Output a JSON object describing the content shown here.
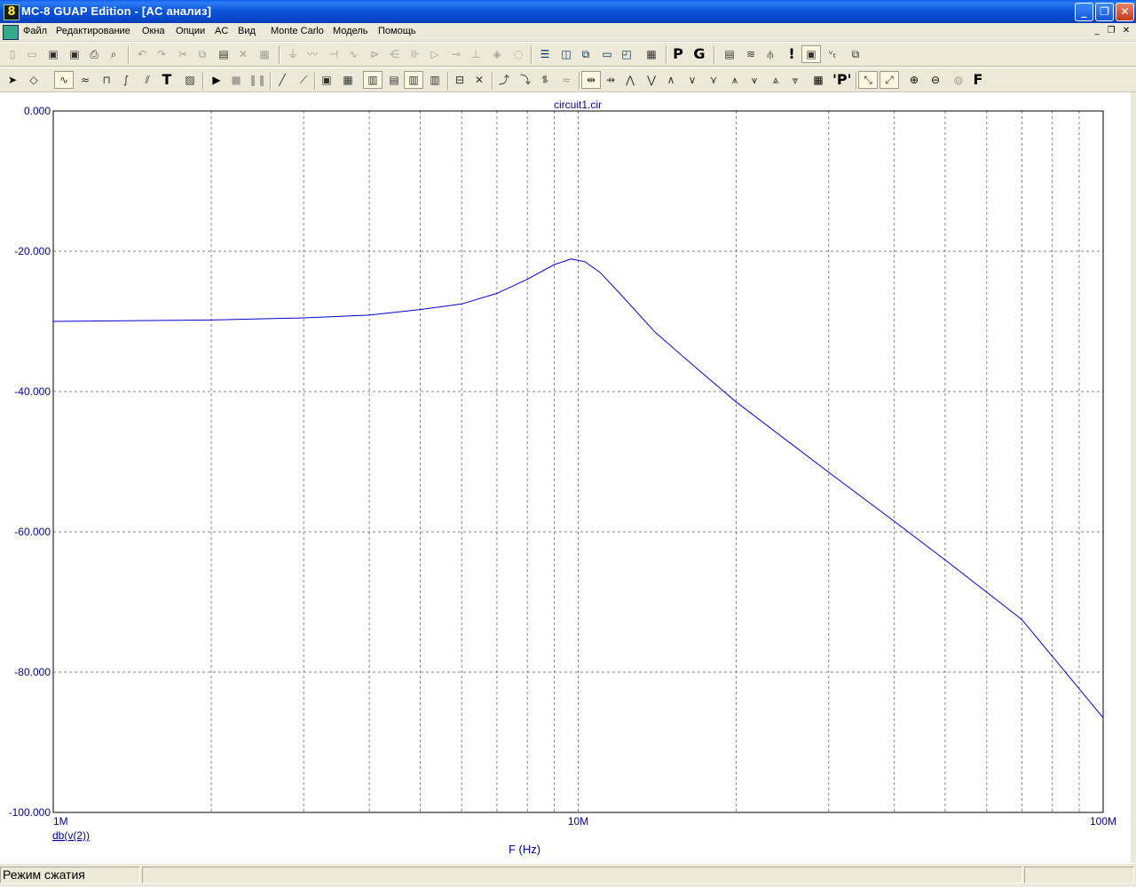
{
  "window": {
    "title": "MC-8 GUAP Edition - [AC анализ]",
    "app_icon_glyph": "8",
    "minimize_glyph": "_",
    "restore_glyph": "❐",
    "close_glyph": "✕"
  },
  "menu": {
    "items": [
      "Файл",
      "Редактирование",
      "Окна",
      "Опции",
      "AC",
      "Вид",
      "Monte Carlo",
      "Модель",
      "Помощь"
    ],
    "mdi_minimize": "_",
    "mdi_restore": "❐",
    "mdi_close": "✕"
  },
  "toolbar1": {
    "p_label": "P",
    "g_label": "G"
  },
  "toolbar2": {
    "text_tool": "T",
    "p_quote_label": "'P'",
    "f_label": "F"
  },
  "plot": {
    "title": "circuit1.cir",
    "xlabel": "F (Hz)",
    "trace_label": "db(v(2))",
    "colors": {
      "trace": "#0000cc",
      "axis_text": "#000099",
      "grid": "#808080"
    }
  },
  "chart_data": {
    "type": "line",
    "title": "circuit1.cir",
    "xlabel": "F (Hz)",
    "ylabel": "",
    "xscale": "log",
    "xlim": [
      1000000,
      100000000
    ],
    "ylim": [
      -100,
      0
    ],
    "x_tick_labels": [
      "1M",
      "10M",
      "100M"
    ],
    "y_tick_labels": [
      "0.000",
      "-20.000",
      "-40.000",
      "-60.000",
      "-80.000",
      "-100.000"
    ],
    "grid": true,
    "series": [
      {
        "name": "db(v(2))",
        "x": [
          1000000,
          2000000,
          3000000,
          4000000,
          5000000,
          6000000,
          7000000,
          8000000,
          9000000,
          9700000,
          10300000,
          11000000,
          12000000,
          14000000,
          17000000,
          20000000,
          30000000,
          40000000,
          50000000,
          70000000,
          100000000
        ],
        "y": [
          -30.0,
          -29.8,
          -29.5,
          -29.1,
          -28.3,
          -27.5,
          -26.0,
          -24.0,
          -21.9,
          -21.1,
          -21.5,
          -23.0,
          -26.0,
          -31.5,
          -37.0,
          -41.5,
          -51.5,
          -58.5,
          -64.0,
          -72.5,
          -86.5
        ]
      }
    ]
  },
  "status": {
    "mode": "Режим сжатия"
  }
}
